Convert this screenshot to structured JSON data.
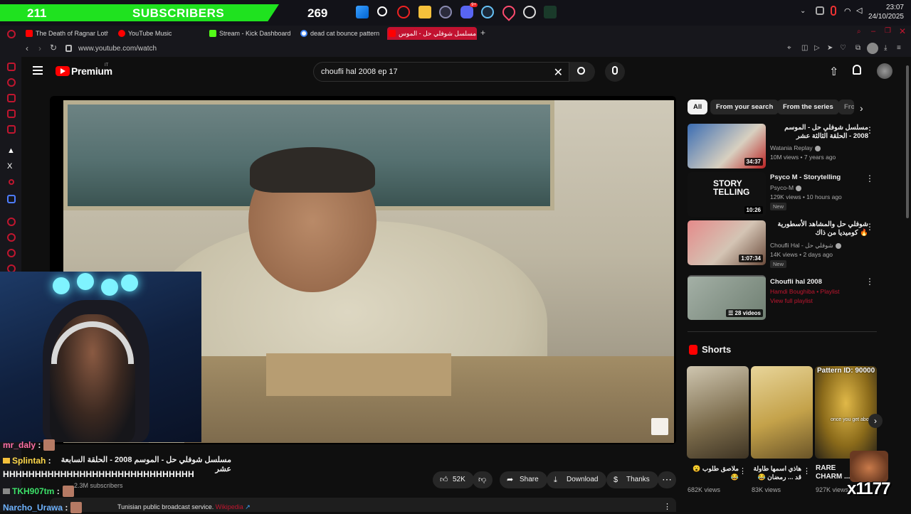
{
  "taskbar": {
    "subscriber_count": "211",
    "subscriber_label": "SUBSCRIBERS",
    "viewer_count": "269",
    "clock_time": "23:07",
    "clock_date": "24/10/2025",
    "discord_badge": "9+"
  },
  "tabs": [
    {
      "label": "The Death of Ragnar Loth",
      "icon": "youtube-icon",
      "color": "#ff0000"
    },
    {
      "label": "YouTube Music",
      "icon": "youtube-music-icon",
      "color": "#ff0000"
    },
    {
      "label": "Stream - Kick Dashboard",
      "icon": "kick-icon",
      "color": "#53fc18"
    },
    {
      "label": "dead cat bounce pattern",
      "icon": "google-icon",
      "color": "#4285f4"
    },
    {
      "label": "مسلسل شوفلي حل - الموس...",
      "icon": "youtube-icon",
      "color": "#ff0000"
    }
  ],
  "address": {
    "url": "www.youtube.com/watch"
  },
  "header": {
    "premium_label": "Premium",
    "region": "IT",
    "search_value": "choufli hal 2008 ep 17"
  },
  "video": {
    "title": "مسلسل شوفلي حل - الموسم 2008 - الحلقة السابعة عشر",
    "subscribers": "2.3M subscribers",
    "likes": "52K",
    "share_label": "Share",
    "download_label": "Download",
    "thanks_label": "Thanks",
    "description": "Tunisian public broadcast service.",
    "description_link": "Wikipedia"
  },
  "chat": [
    {
      "user": "mr_daly",
      "color": "#ff6fa7",
      "message": ""
    },
    {
      "user": "Splintah",
      "color": "#ffd84a",
      "message": ""
    },
    {
      "user": "TKH907tm",
      "color": "#3ce068",
      "message": ""
    },
    {
      "user": "Narcho_Urawa",
      "color": "#6fb3ff",
      "message": ""
    }
  ],
  "chat_message": "HHHHHHHHHHHHHHHHHHHHHHHHHHHHHH",
  "chips": [
    "All",
    "From your search",
    "From the series",
    "Fro"
  ],
  "recommendations": [
    {
      "title": "مسلسل شوفلي حل - الموسم 2008 - الحلقة الثالثة عشر",
      "channel": "Watania Replay",
      "meta": "10M views • 7 years ago",
      "duration": "34:37",
      "new": "",
      "rtl": true,
      "thumb_color": "#4a7fc9"
    },
    {
      "title": "Psyco M - Storytelling",
      "channel": "Psyco-M",
      "meta": "129K views • 10 hours ago",
      "duration": "10:26",
      "new": "New",
      "rtl": false,
      "thumb_color": "#121212"
    },
    {
      "title": "شوفلي حل والمشاهد الأسطورية 🔥 كوميديا من ذاك",
      "channel": "Choufli Hal - شوفلي حل",
      "meta": "14K views • 2 days ago",
      "duration": "1:07:34",
      "new": "New",
      "rtl": true,
      "thumb_color": "#b66a6a"
    },
    {
      "title": "Choufli hal 2008",
      "channel": "Hamdi Boughiba • Playlist",
      "meta": "View full playlist",
      "duration": "28 videos",
      "new": "",
      "rtl": false,
      "thumb_color": "#8a9a8c"
    }
  ],
  "shorts": {
    "heading": "Shorts",
    "items": [
      {
        "title": "ملاصق طلوب 😮😂",
        "views": "682K views",
        "color": "#7a6a4a"
      },
      {
        "title": "هاذي اسمها طاولة قد ... رمضان 😂",
        "views": "83K views",
        "color": "#c4a24a"
      },
      {
        "title": "RARE CHARM ...",
        "views": "927K views",
        "color": "#c7a03a"
      }
    ],
    "pattern_label": "Pattern ID: 90000",
    "short_overlay": "once you get abov"
  },
  "overlay_text": "x1177"
}
